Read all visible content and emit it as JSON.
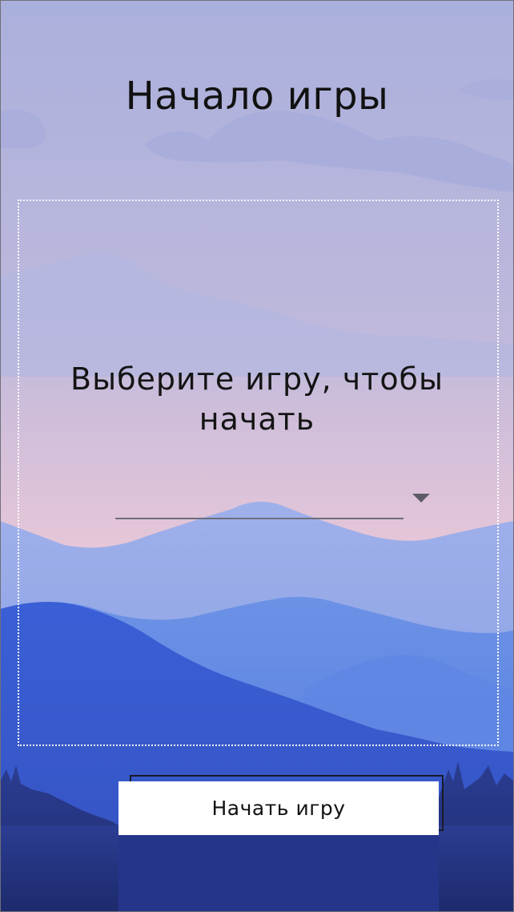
{
  "screen": {
    "title": "Начало игры",
    "prompt": "Выберите игру, чтобы начать",
    "game_select": {
      "value": ""
    },
    "start_button_label": "Начать игру"
  },
  "colors": {
    "sky_top": "#aab0dc",
    "sky_bottom": "#e6c6d8",
    "mountain_far": "#8fa6e6",
    "mountain_mid": "#6b8fe0",
    "mountain_near": "#3d5fcf",
    "forest": "#24327a",
    "button_bg": "#ffffff"
  }
}
